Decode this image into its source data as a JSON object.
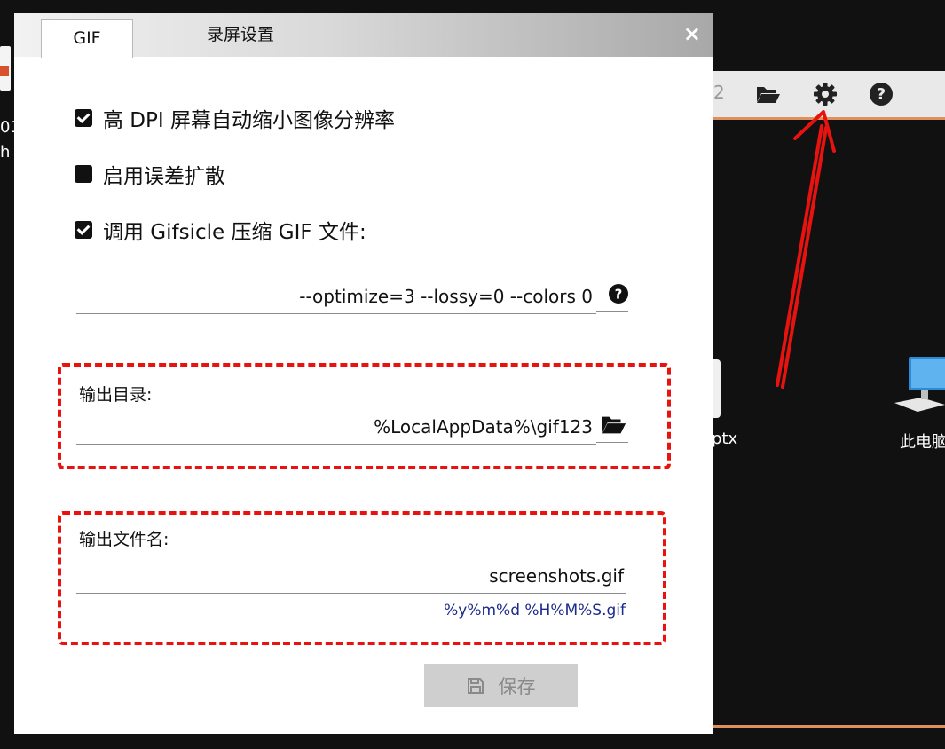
{
  "dialog": {
    "tabs": [
      {
        "label": "GIF"
      },
      {
        "label": "录屏设置"
      }
    ],
    "close_symbol": "×",
    "options": [
      {
        "label": "高 DPI 屏幕自动缩小图像分辨率",
        "checked": true
      },
      {
        "label": "启用误差扩散",
        "checked": false
      },
      {
        "label": "调用 Gifsicle 压缩 GIF 文件:",
        "checked": true
      }
    ],
    "gifsicle_args": {
      "value": "--optimize=3 --lossy=0 --colors 0",
      "icon": "help-icon"
    },
    "output_dir": {
      "label": "输出目录:",
      "value": "%LocalAppData%\\gif123",
      "icon": "folder-open-icon"
    },
    "output_filename": {
      "label": "输出文件名:",
      "value": "screenshots.gif",
      "hint": "%y%m%d %H%M%S.gif"
    },
    "save_button": {
      "label": "保存",
      "icon": "save-icon",
      "enabled": false
    }
  },
  "background": {
    "toolbar": {
      "fragment": "2",
      "icons": [
        "folder-open-icon",
        "gear-icon",
        "help-icon"
      ]
    },
    "desktop_items": [
      {
        "label": "ptx"
      },
      {
        "label": "此电脑",
        "icon": "computer-icon"
      }
    ],
    "left_edge_text": [
      "01",
      "h"
    ]
  },
  "colors": {
    "highlight_dash": "#e8130e",
    "arrow": "#e8130e",
    "hint_text": "#1b2a8c",
    "accent_line": "#e08e5c"
  }
}
